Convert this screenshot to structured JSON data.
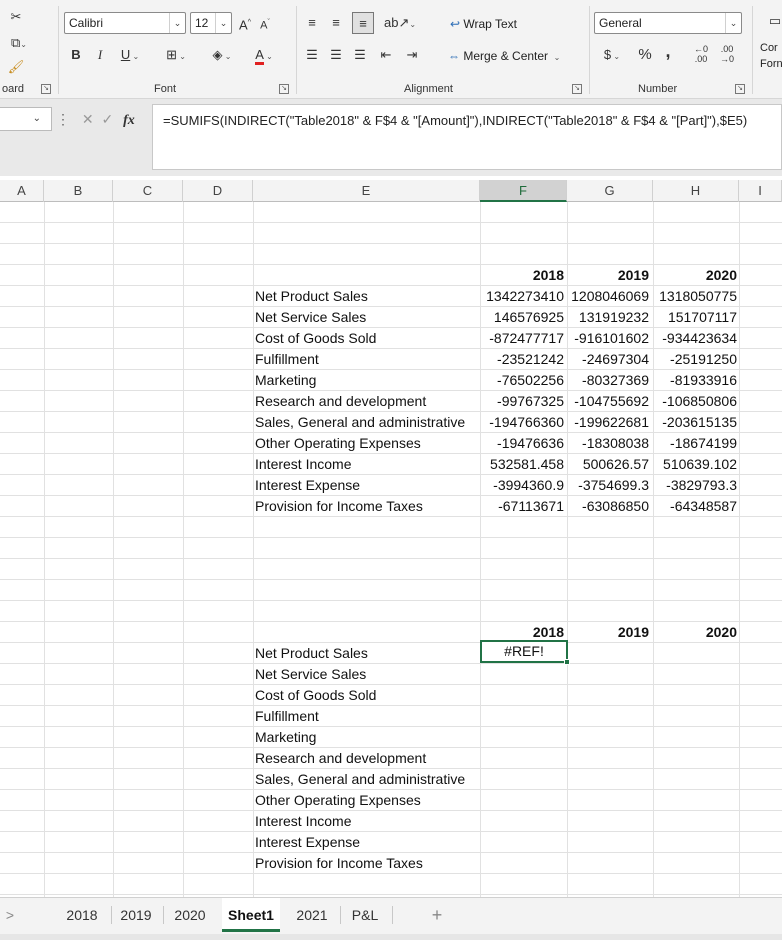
{
  "ribbon": {
    "clipboard_label": "oard",
    "font": {
      "name": "Calibri",
      "size": "12",
      "label": "Font"
    },
    "alignment": {
      "wrap_text": "Wrap Text",
      "merge_center": "Merge & Center",
      "label": "Alignment"
    },
    "number": {
      "format": "General",
      "currency": "$",
      "percent": "%",
      "comma": ",",
      "label": "Number"
    },
    "styles": {
      "cond_top": "Cor",
      "cond_bottom": "Forn"
    }
  },
  "formula_bar": {
    "fx": "fx",
    "formula": "=SUMIFS(INDIRECT(\"Table2018\" & F$4 & \"[Amount]\"),INDIRECT(\"Table2018\" & F$4 & \"[Part]\"),$E5)"
  },
  "columns": [
    "A",
    "B",
    "C",
    "D",
    "E",
    "F",
    "G",
    "H",
    "I"
  ],
  "top_table": {
    "years": [
      "2018",
      "2019",
      "2020"
    ],
    "rows": [
      {
        "label": "Net Product Sales",
        "values": [
          "1342273410",
          "1208046069",
          "1318050775"
        ]
      },
      {
        "label": "Net Service Sales",
        "values": [
          "146576925",
          "131919232",
          "151707117"
        ]
      },
      {
        "label": "Cost of Goods Sold",
        "values": [
          "-872477717",
          "-916101602",
          "-934423634"
        ]
      },
      {
        "label": "Fulfillment",
        "values": [
          "-23521242",
          "-24697304",
          "-25191250"
        ]
      },
      {
        "label": "Marketing",
        "values": [
          "-76502256",
          "-80327369",
          "-81933916"
        ]
      },
      {
        "label": "Research and development",
        "values": [
          "-99767325",
          "-104755692",
          "-106850806"
        ]
      },
      {
        "label": "Sales, General and administrative",
        "values": [
          "-194766360",
          "-199622681",
          "-203615135"
        ]
      },
      {
        "label": "Other Operating Expenses",
        "values": [
          "-19476636",
          "-18308038",
          "-18674199"
        ]
      },
      {
        "label": "Interest Income",
        "values": [
          "532581.458",
          "500626.57",
          "510639.102"
        ]
      },
      {
        "label": "Interest Expense",
        "values": [
          "-3994360.9",
          "-3754699.3",
          "-3829793.3"
        ]
      },
      {
        "label": "Provision for Income Taxes",
        "values": [
          "-67113671",
          "-63086850",
          "-64348587"
        ]
      }
    ]
  },
  "bottom_table": {
    "years": [
      "2018",
      "2019",
      "2020"
    ],
    "selected_value": "#REF!",
    "rows": [
      "Net Product Sales",
      "Net Service Sales",
      "Cost of Goods Sold",
      "Fulfillment",
      "Marketing",
      "Research and development",
      "Sales, General and administrative",
      "Other Operating Expenses",
      "Interest Income",
      "Interest Expense",
      "Provision for Income Taxes"
    ]
  },
  "sheet_tabs": [
    "2018",
    "2019",
    "2020",
    "Sheet1",
    "2021",
    "P&L"
  ],
  "active_tab": "Sheet1",
  "accent_color": "#217346"
}
